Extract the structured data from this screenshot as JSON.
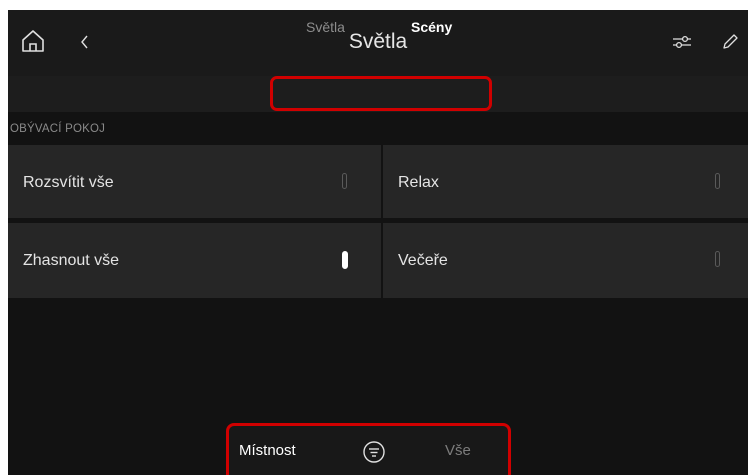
{
  "header": {
    "title": "Světla",
    "icons": [
      "home-icon",
      "chevron-left-icon",
      "sliders-icon",
      "pencil-icon"
    ]
  },
  "tabs": [
    {
      "label": "Světla",
      "active": false
    },
    {
      "label": "Scény",
      "active": true
    }
  ],
  "section": {
    "label": "OBÝVACÍ POKOJ"
  },
  "scenes": [
    {
      "label": "Rozsvítit vše",
      "active": false
    },
    {
      "label": "Relax",
      "active": false
    },
    {
      "label": "Zhasnout vše",
      "active": true
    },
    {
      "label": "Večeře",
      "active": false
    }
  ],
  "bottom_bar": {
    "room_label": "Místnost",
    "filter_icon": "filter-icon",
    "all_label": "Vše"
  },
  "colors": {
    "highlight": "#d00000",
    "background": "#121212",
    "tile": "#262626"
  }
}
